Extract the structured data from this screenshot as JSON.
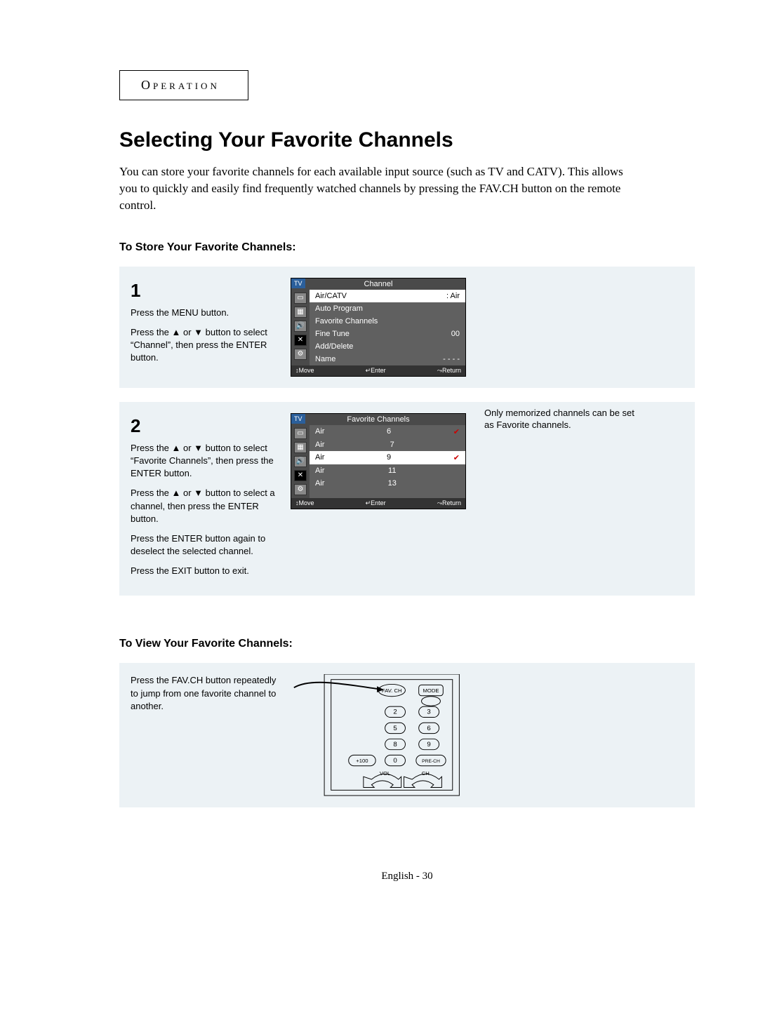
{
  "tab_label": "Operation",
  "title": "Selecting Your Favorite Channels",
  "intro": "You can store your favorite channels for each available input source (such as TV and CATV). This allows you to quickly and easily find frequently watched channels by pressing the FAV.CH button on the remote control.",
  "store_heading": "To Store Your Favorite Channels:",
  "step1": {
    "num": "1",
    "line1": "Press the MENU button.",
    "line2": "Press the ▲ or ▼ button to select “Channel”, then press the ENTER button."
  },
  "osd1": {
    "tv": "TV",
    "title": "Channel",
    "rows": [
      {
        "l": "Air/CATV",
        "r": ": Air",
        "sel": true
      },
      {
        "l": "Auto Program",
        "r": "",
        "sel": false
      },
      {
        "l": "Favorite Channels",
        "r": "",
        "sel": false
      },
      {
        "l": "Fine Tune",
        "r": "00",
        "sel": false
      },
      {
        "l": "Add/Delete",
        "r": "",
        "sel": false
      },
      {
        "l": "Name",
        "r": "- - - -",
        "sel": false
      }
    ],
    "footer": {
      "move": "↕Move",
      "enter": "↵Enter",
      "ret": "⤳Return"
    }
  },
  "step2": {
    "num": "2",
    "p1": "Press the ▲ or ▼ button to select “Favorite Channels”, then press the ENTER button.",
    "p2": "Press the ▲ or ▼ button to select a channel, then press the ENTER button.",
    "p3": "Press the ENTER button again to deselect the selected channel.",
    "p4": "Press the EXIT button to exit."
  },
  "osd2": {
    "tv": "TV",
    "title": "Favorite Channels",
    "rows": [
      {
        "l": "Air",
        "r": "6",
        "chk": "✔",
        "sel": false
      },
      {
        "l": "Air",
        "r": "7",
        "chk": "",
        "sel": false
      },
      {
        "l": "Air",
        "r": "9",
        "chk": "✔",
        "sel": true
      },
      {
        "l": "Air",
        "r": "11",
        "chk": "",
        "sel": false
      },
      {
        "l": "Air",
        "r": "13",
        "chk": "",
        "sel": false
      }
    ],
    "footer": {
      "move": "↕Move",
      "enter": "↵Enter",
      "ret": "⤳Return"
    }
  },
  "side_note": "Only memorized channels can be set as Favorite channels.",
  "view_heading": "To View Your Favorite Channels:",
  "view_text": "Press the FAV.CH button repeatedly to jump from one favorite channel to another.",
  "remote": {
    "favch": "FAV. CH",
    "mode": "MODE",
    "k2": "2",
    "k3": "3",
    "k5": "5",
    "k6": "6",
    "k8": "8",
    "k9": "9",
    "k100": "+100",
    "k0": "0",
    "prech": "PRE-CH",
    "vol": "VOL",
    "ch": "CH"
  },
  "page_footer": "English - 30"
}
